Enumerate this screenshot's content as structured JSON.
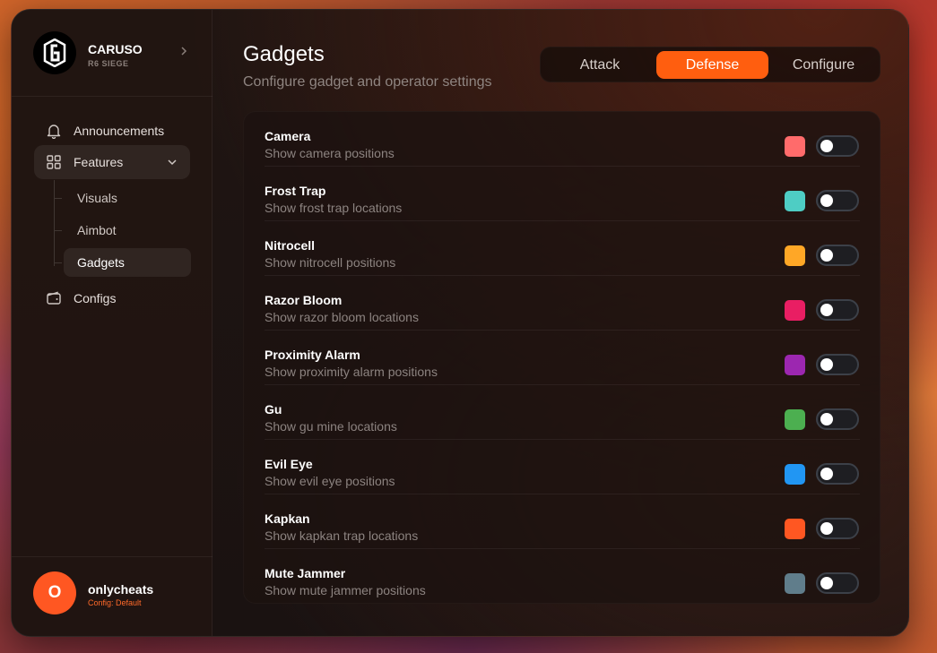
{
  "app": {
    "name": "CARUSO",
    "subtitle": "R6 SIEGE"
  },
  "sidebar": {
    "items": [
      {
        "label": "Announcements",
        "icon": "bell-icon"
      },
      {
        "label": "Features",
        "icon": "grid-icon",
        "expanded": true,
        "children": [
          {
            "label": "Visuals"
          },
          {
            "label": "Aimbot"
          },
          {
            "label": "Gadgets",
            "active": true
          }
        ]
      },
      {
        "label": "Configs",
        "icon": "wallet-icon"
      }
    ]
  },
  "user": {
    "initial": "O",
    "name": "onlycheats",
    "config": "Config: Default"
  },
  "page": {
    "title": "Gadgets",
    "subtitle": "Configure gadget and operator settings"
  },
  "tabs": [
    {
      "label": "Attack"
    },
    {
      "label": "Defense",
      "active": true
    },
    {
      "label": "Configure"
    }
  ],
  "gadgets": [
    {
      "name": "Camera",
      "desc": "Show camera positions",
      "color": "#ff6b6b",
      "enabled": false
    },
    {
      "name": "Frost Trap",
      "desc": "Show frost trap locations",
      "color": "#4ecdc4",
      "enabled": false
    },
    {
      "name": "Nitrocell",
      "desc": "Show nitrocell positions",
      "color": "#ffa726",
      "enabled": false
    },
    {
      "name": "Razor Bloom",
      "desc": "Show razor bloom locations",
      "color": "#e91e63",
      "enabled": false
    },
    {
      "name": "Proximity Alarm",
      "desc": "Show proximity alarm positions",
      "color": "#9c27b0",
      "enabled": false
    },
    {
      "name": "Gu",
      "desc": "Show gu mine locations",
      "color": "#4caf50",
      "enabled": false
    },
    {
      "name": "Evil Eye",
      "desc": "Show evil eye positions",
      "color": "#2196f3",
      "enabled": false
    },
    {
      "name": "Kapkan",
      "desc": "Show kapkan trap locations",
      "color": "#ff5722",
      "enabled": false
    },
    {
      "name": "Mute Jammer",
      "desc": "Show mute jammer positions",
      "color": "#607d8b",
      "enabled": false
    }
  ],
  "colors": {
    "accent": "#ff5e0f",
    "avatar": "#ff5722"
  }
}
